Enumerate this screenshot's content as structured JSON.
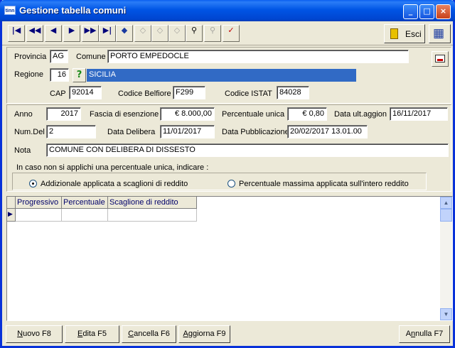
{
  "window": {
    "icon_text": "tinn",
    "title": "Gestione tabella comuni"
  },
  "toolbar": {
    "esci_label": "Esci"
  },
  "location": {
    "provincia_label": "Provincia",
    "provincia_value": "AG",
    "comune_label": "Comune",
    "comune_value": "PORTO EMPEDOCLE",
    "regione_label": "Regione",
    "regione_code": "16",
    "regione_name": "SICILIA",
    "cap_label": "CAP",
    "cap_value": "92014",
    "belfiore_label": "Codice Belfiore",
    "belfiore_value": "F299",
    "istat_label": "Codice ISTAT",
    "istat_value": "84028"
  },
  "details": {
    "anno_label": "Anno",
    "anno_value": "2017",
    "fascia_label": "Fascia di esenzione",
    "fascia_value": "€ 8.000,00",
    "perc_unica_label": "Percentuale unica",
    "perc_unica_value": "€ 0,80",
    "data_ult_label": "Data ult.aggion",
    "data_ult_value": "16/11/2017",
    "numdel_label": "Num.Del",
    "numdel_value": "2",
    "data_delibera_label": "Data Delibera",
    "data_delibera_value": "11/01/2017",
    "data_pubbl_label": "Data Pubblicazione",
    "data_pubbl_value": "20/02/2017 13.01.00",
    "nota_label": "Nota",
    "nota_value": "COMUNE CON DELIBERA DI DISSESTO",
    "hint": "In caso non si applichi una percentuale unica, indicare :",
    "radio_scaglioni": "Addizionale applicata a scaglioni di reddito",
    "radio_massima": "Percentuale massima applicata sull'intero reddito",
    "selected_radio": "scaglioni"
  },
  "grid": {
    "columns": [
      "Progressivo",
      "Percentuale",
      "Scaglione di reddito"
    ],
    "rows": []
  },
  "buttons": {
    "nuovo_u": "N",
    "nuovo_rest": "uovo F8",
    "edita_u": "E",
    "edita_rest": "dita F5",
    "cancella_u": "C",
    "cancella_rest": "ancella F6",
    "aggiorna_u": "A",
    "aggiorna_rest": "ggiorna F9",
    "annulla_pre": "A",
    "annulla_u": "n",
    "annulla_rest": "nulla F7"
  },
  "icons": {
    "nav": [
      "first-icon",
      "prev-page-icon",
      "prev-icon",
      "next-icon",
      "next-page-icon",
      "last-icon"
    ],
    "actions": [
      "add-record-icon",
      "edit-record-icon",
      "delete-record-icon",
      "save-record-icon",
      "search-icon",
      "search-next-icon",
      "clear-filter-icon"
    ]
  }
}
